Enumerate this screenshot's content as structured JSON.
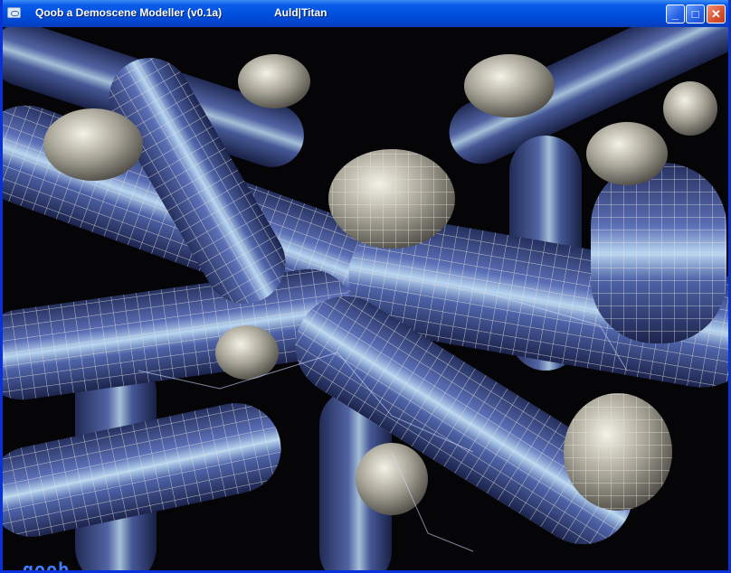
{
  "window": {
    "title": "Qoob a Demoscene Modeller (v0.1a)",
    "credits": "Auld|Titan",
    "controls": {
      "minimize": "_",
      "maximize": "□",
      "close": "✕"
    }
  },
  "viewport": {
    "logo_text": "qoob",
    "colors": {
      "tube_base": "#3b4a8a",
      "tube_highlight": "#b8d6f0",
      "wire": "#e8e4d8",
      "blob": "#c9c6b8",
      "background": "#050507"
    }
  }
}
